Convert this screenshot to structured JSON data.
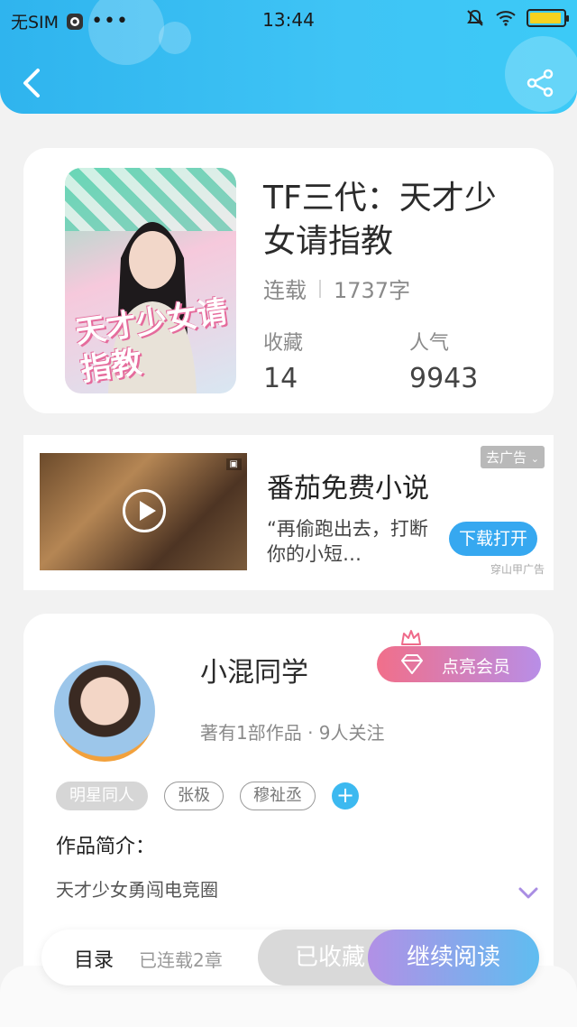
{
  "status_bar": {
    "carrier": "无SIM",
    "time": "13:44",
    "battery_level": 0.95
  },
  "book": {
    "title": "TF三代：天才少女请指教",
    "status": "连载",
    "word_count": "1737字",
    "favorites_label": "收藏",
    "favorites_value": "14",
    "popularity_label": "人气",
    "popularity_value": "9943",
    "cover_title": "天才少女请指教"
  },
  "ad": {
    "tag": "去广告",
    "title": "番茄免费小说",
    "description": "“再偷跑出去，打断你的小短…",
    "button": "下载打开",
    "source": "穿山甲广告"
  },
  "author": {
    "name": "小混同学",
    "vip_button": "点亮会员",
    "summary": "著有1部作品 · 9人关注",
    "tags": [
      "明星同人",
      "张极",
      "穆祉丞"
    ],
    "intro_label": "作品简介：",
    "intro_text": "天才少女勇闯电竞圈"
  },
  "bottom_bar": {
    "toc": "目录",
    "serial": "已连载2章",
    "collected": "已收藏",
    "continue": "继续阅读"
  },
  "colors": {
    "header": "#3cbdf4",
    "accent": "#3cb9f0",
    "vip_gradient_start": "#f16f8a",
    "vip_gradient_end": "#b88ee7"
  }
}
